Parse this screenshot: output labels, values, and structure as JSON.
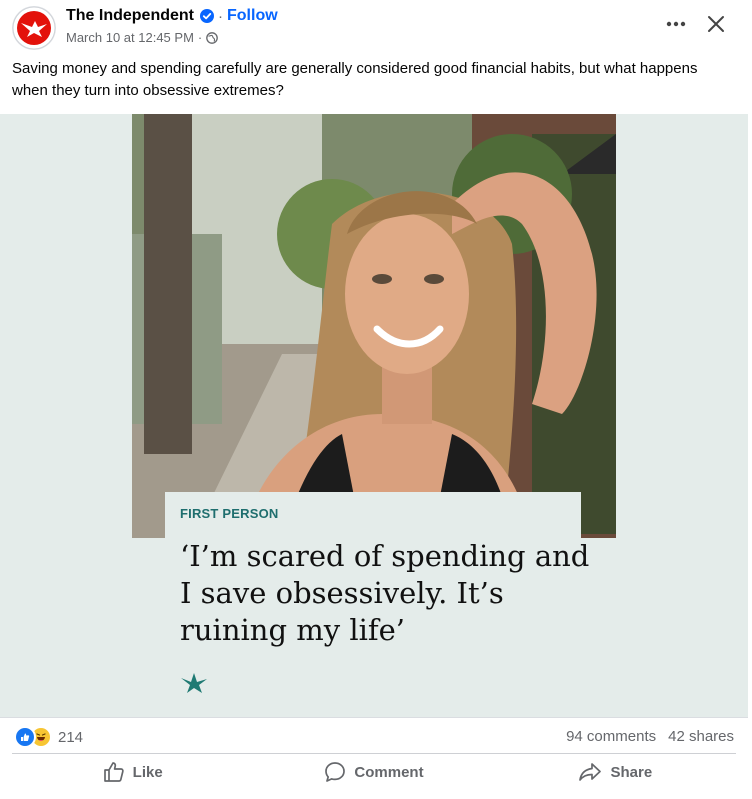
{
  "post": {
    "page_name": "The Independent",
    "follow_label": "Follow",
    "separator": "·",
    "timestamp": "March 10 at 12:45 PM",
    "caption": "Saving money and spending carefully are generally considered good financial habits, but what happens when they turn into obsessive extremes?"
  },
  "card": {
    "section_label": "FIRST PERSON",
    "headline": "‘I’m scared of spending and I save obsessively. It’s ruining my life’"
  },
  "stats": {
    "reaction_count": "214",
    "comments": "94 comments",
    "shares": "42 shares"
  },
  "actions": {
    "like": "Like",
    "comment": "Comment",
    "share": "Share"
  },
  "icons": {
    "avatar": "independent-eagle-logo",
    "verified": "verified-badge-icon",
    "audience": "globe-icon",
    "more": "more-icon",
    "close": "close-icon",
    "reactions": [
      "like-reaction-icon",
      "haha-reaction-icon"
    ]
  },
  "colors": {
    "brand_red": "#e3120b",
    "facebook_blue": "#0866ff",
    "muted_text": "#65676b",
    "card_bg": "#e4ecea",
    "section_teal": "#1e6e6e"
  }
}
